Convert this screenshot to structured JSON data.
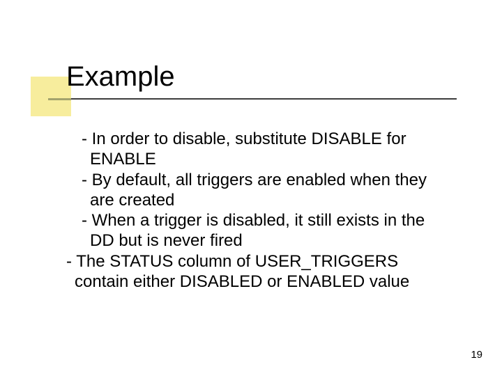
{
  "slide": {
    "title": "Example",
    "bullets": [
      "- In order to disable, substitute DISABLE for ENABLE",
      "- By default, all triggers are enabled when they are created",
      "- When a trigger is disabled, it still exists in the DD but is never fired",
      "- The STATUS column of USER_TRIGGERS contain either DISABLED or ENABLED value"
    ],
    "page_number": "19"
  }
}
